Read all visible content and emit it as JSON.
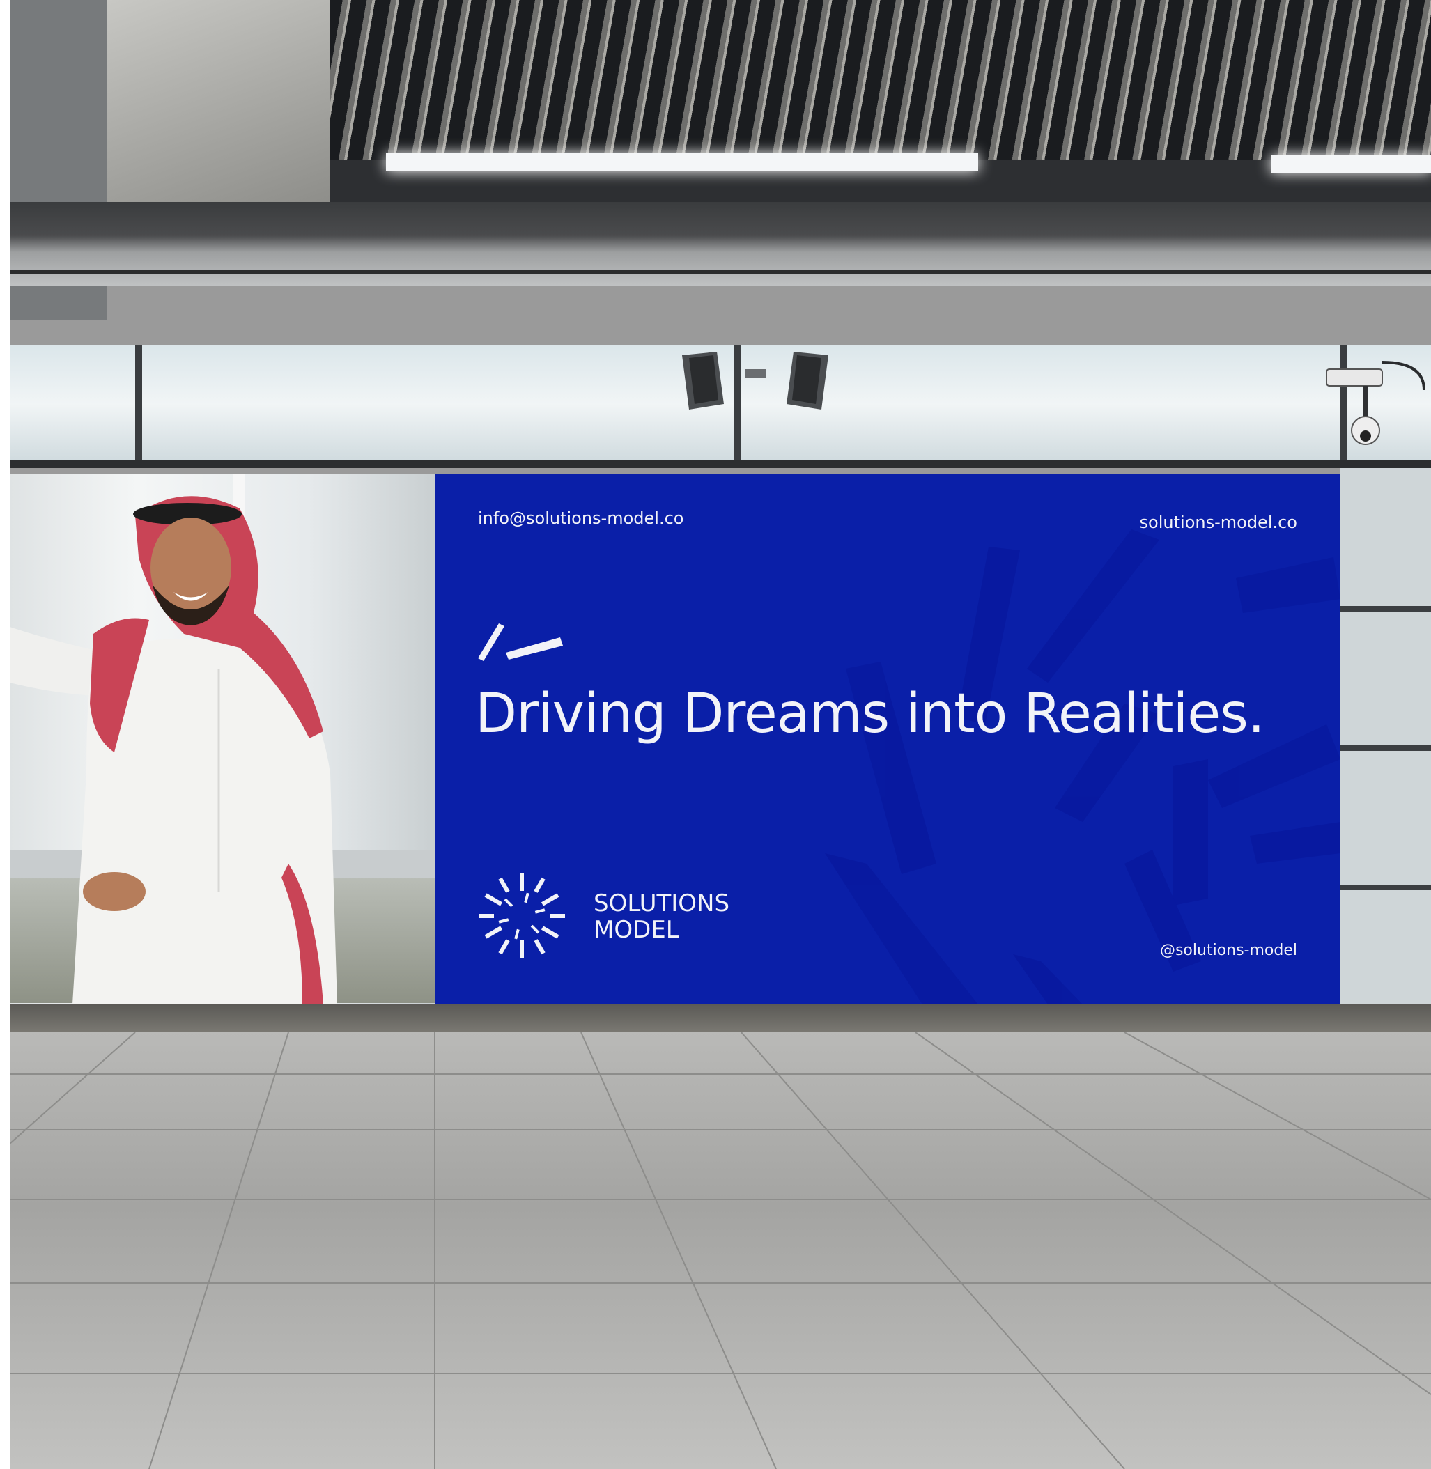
{
  "scene": {
    "description_free": true,
    "billboard": {
      "email": "info@solutions-model.co",
      "website": "solutions-model.co",
      "headline": "Driving Dreams into Realities.",
      "logo_line1": "SOLUTIONS",
      "logo_line2": "MODEL",
      "social_handle": "@solutions-model",
      "background_color": "#0a1fa8",
      "text_color": "#f2f3f8"
    },
    "icons": [
      "logo-sunburst-icon",
      "quote-slash-icon",
      "security-camera-icon",
      "speaker-icon"
    ]
  }
}
